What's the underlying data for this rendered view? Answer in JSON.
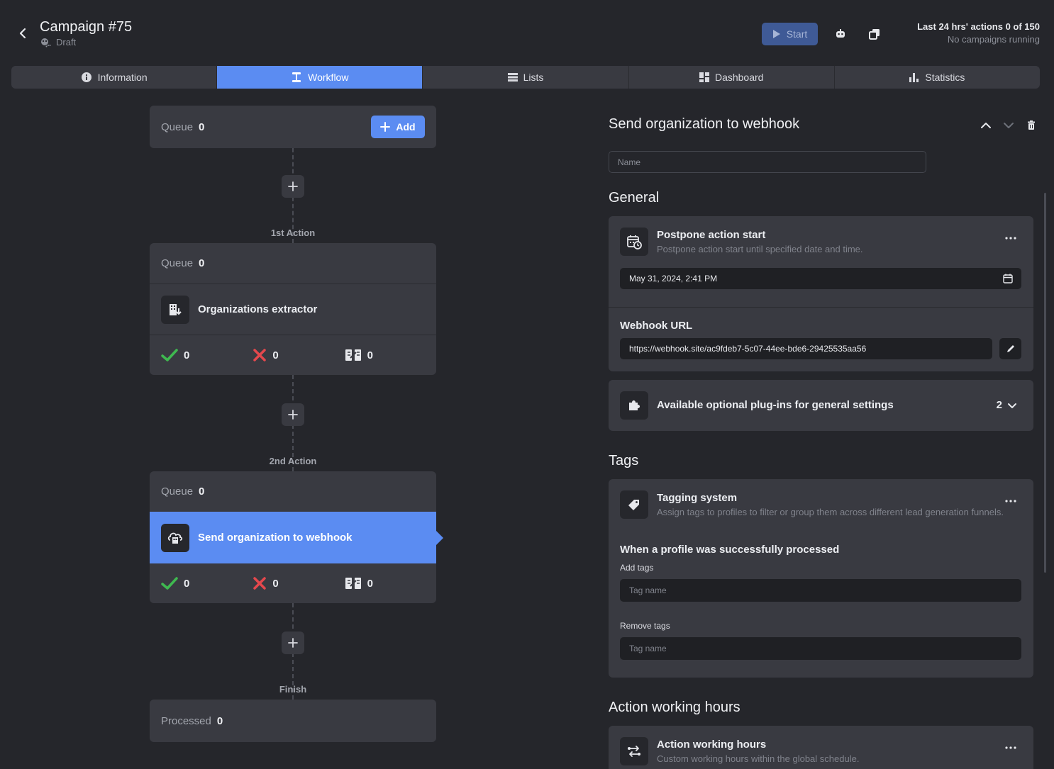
{
  "header": {
    "title": "Campaign #75",
    "status": "Draft",
    "start_label": "Start",
    "stats_line1": "Last 24 hrs' actions 0 of 150",
    "stats_line2": "No campaigns running"
  },
  "tabs": [
    {
      "label": "Information",
      "icon": "info-icon"
    },
    {
      "label": "Workflow",
      "icon": "workflow-icon"
    },
    {
      "label": "Lists",
      "icon": "list-icon"
    },
    {
      "label": "Dashboard",
      "icon": "dashboard-icon"
    },
    {
      "label": "Statistics",
      "icon": "statistics-icon"
    }
  ],
  "workflow": {
    "start_queue": {
      "label": "Queue",
      "value": "0",
      "add_label": "Add"
    },
    "actions": [
      {
        "step_label": "1st Action",
        "queue_label": "Queue",
        "queue_value": "0",
        "name": "Organizations extractor",
        "success": "0",
        "failed": "0",
        "skipped": "0"
      },
      {
        "step_label": "2nd Action",
        "queue_label": "Queue",
        "queue_value": "0",
        "name": "Send organization to webhook",
        "success": "0",
        "failed": "0",
        "skipped": "0"
      }
    ],
    "finish": {
      "step_label": "Finish",
      "label": "Processed",
      "value": "0"
    }
  },
  "panel": {
    "title": "Send organization to webhook",
    "name_placeholder": "Name",
    "general": {
      "title": "General",
      "postpone": {
        "title": "Postpone action start",
        "desc": "Postpone action start until specified date and time.",
        "date_value": "May 31, 2024, 2:41 PM"
      },
      "webhook": {
        "label": "Webhook URL",
        "value": "https://webhook.site/ac9fdeb7-5c07-44ee-bde6-29425535aa56"
      },
      "plugins": {
        "title": "Available optional plug-ins for general settings",
        "count": "2"
      }
    },
    "tags": {
      "title": "Tags",
      "system_title": "Tagging system",
      "system_desc": "Assign tags to profiles to filter or group them across different lead generation funnels.",
      "when_label": "When a profile was successfully processed",
      "add_label": "Add tags",
      "add_placeholder": "Tag name",
      "remove_label": "Remove tags",
      "remove_placeholder": "Tag name"
    },
    "hours": {
      "title": "Action working hours",
      "card_title": "Action working hours",
      "card_desc": "Custom working hours within the global schedule."
    }
  },
  "colors": {
    "background": "#25262b",
    "card": "#393a41",
    "accent": "#5b8cf2",
    "success": "#3fb950",
    "error": "#e5484d"
  }
}
